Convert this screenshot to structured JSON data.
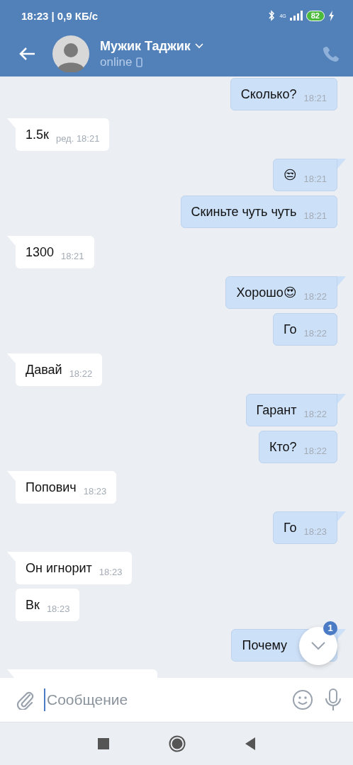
{
  "status_bar": {
    "time": "18:23",
    "speed": "| 0,9 КБ/с",
    "network": "4G",
    "battery": "82",
    "charging": true
  },
  "header": {
    "contact_name": "Мужик Таджик",
    "status": "online",
    "mobile": true
  },
  "messages": [
    {
      "kind": "out",
      "text": "Сколько?",
      "time": "18:21",
      "tail": false
    },
    {
      "kind": "in",
      "text": "1.5к",
      "time": "ред. 18:21",
      "tail": true
    },
    {
      "kind": "out",
      "text": "😒",
      "time": "18:21",
      "tail": true
    },
    {
      "kind": "out",
      "text": "Скиньте чуть чуть",
      "time": "18:21",
      "tail": false
    },
    {
      "kind": "in",
      "text": "1300",
      "time": "18:21",
      "tail": true
    },
    {
      "kind": "out",
      "text": "Хорошо😍",
      "time": "18:22",
      "tail": true
    },
    {
      "kind": "out",
      "text": "Го",
      "time": "18:22",
      "tail": false
    },
    {
      "kind": "in",
      "text": "Давай",
      "time": "18:22",
      "tail": true
    },
    {
      "kind": "out",
      "text": "Гарант",
      "time": "18:22",
      "tail": true
    },
    {
      "kind": "out",
      "text": "Кто?",
      "time": "18:22",
      "tail": false
    },
    {
      "kind": "in",
      "text": "Попович",
      "time": "18:23",
      "tail": true
    },
    {
      "kind": "out",
      "text": "Го",
      "time": "18:23",
      "tail": true
    },
    {
      "kind": "in",
      "text": "Он игнорит",
      "time": "18:23",
      "tail": true
    },
    {
      "kind": "in",
      "text": "Вк",
      "time": "18:23",
      "tail": false
    },
    {
      "kind": "out",
      "text": "Почему",
      "tail": true
    },
    {
      "kind": "in",
      "tail": true
    }
  ],
  "scroll_button": {
    "badge": "1"
  },
  "composer": {
    "placeholder": "Сообщение"
  }
}
